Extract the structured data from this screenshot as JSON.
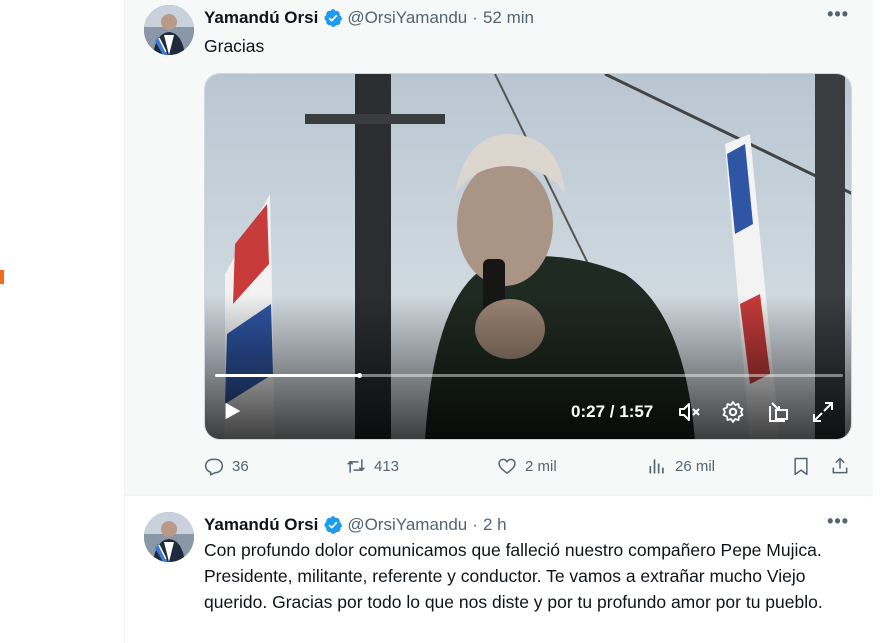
{
  "tweets": [
    {
      "author_name": "Yamandú Orsi",
      "handle": "@OrsiYamandu",
      "separator": "·",
      "time": "52 min",
      "text": "Gracias",
      "video": {
        "current_time": "0:27",
        "separator": "/",
        "duration": "1:57",
        "progress": 0.23
      },
      "actions": {
        "replies": "36",
        "reposts": "413",
        "likes": "2 mil",
        "views": "26 mil"
      }
    },
    {
      "author_name": "Yamandú Orsi",
      "handle": "@OrsiYamandu",
      "separator": "·",
      "time": "2 h",
      "text": "Con profundo dolor comunicamos que falleció nuestro compañero Pepe Mujica. Presidente, militante, referente y conductor. Te vamos a extrañar mucho Viejo querido. Gracias por todo lo que nos diste y por tu profundo amor por tu pueblo."
    }
  ],
  "icons": {
    "verified": "verified-badge-icon",
    "more": "more-icon",
    "reply": "reply-icon",
    "repost": "repost-icon",
    "like": "heart-icon",
    "views": "views-icon",
    "bookmark": "bookmark-icon",
    "share": "share-icon",
    "play": "play-icon",
    "mute": "mute-icon",
    "settings": "gear-icon",
    "pip": "picture-in-picture-icon",
    "fullscreen": "fullscreen-icon"
  },
  "colors": {
    "verified": "#1d9bf0",
    "muted_text": "#536471",
    "accent_mark": "#f26b1d"
  }
}
